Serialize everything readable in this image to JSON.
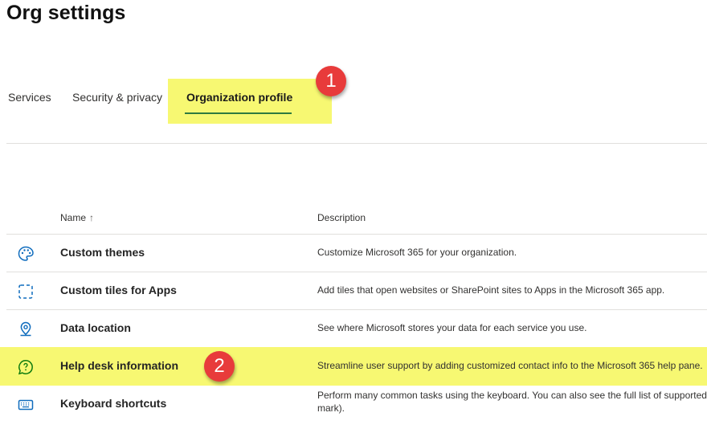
{
  "page": {
    "title": "Org settings"
  },
  "tabs": [
    {
      "label": "Services"
    },
    {
      "label": "Security & privacy"
    },
    {
      "label": "Organization profile"
    }
  ],
  "annotations": {
    "marker_1": "1",
    "marker_2": "2"
  },
  "table": {
    "headers": {
      "name": "Name",
      "sort_indicator": "↑",
      "description": "Description"
    },
    "rows": [
      {
        "icon": "palette-icon",
        "name": "Custom themes",
        "description": "Customize Microsoft 365 for your organization."
      },
      {
        "icon": "dashed-square-icon",
        "name": "Custom tiles for Apps",
        "description": "Add tiles that open websites or SharePoint sites to Apps in the Microsoft 365 app."
      },
      {
        "icon": "location-pin-icon",
        "name": "Data location",
        "description": "See where Microsoft stores your data for each service you use."
      },
      {
        "icon": "chat-help-icon",
        "name": "Help desk information",
        "description": "Streamline user support by adding customized contact info to the Microsoft 365 help pane."
      },
      {
        "icon": "keyboard-icon",
        "name": "Keyboard shortcuts",
        "description": "Perform many common tasks using the keyboard. You can also see the full list of supported mark)."
      }
    ]
  },
  "colors": {
    "highlight": "#f7f872",
    "accent_underline": "#2f7a3f",
    "badge": "#e83b3b",
    "icon": "#0f6cbd",
    "help_icon": "#107c10"
  }
}
